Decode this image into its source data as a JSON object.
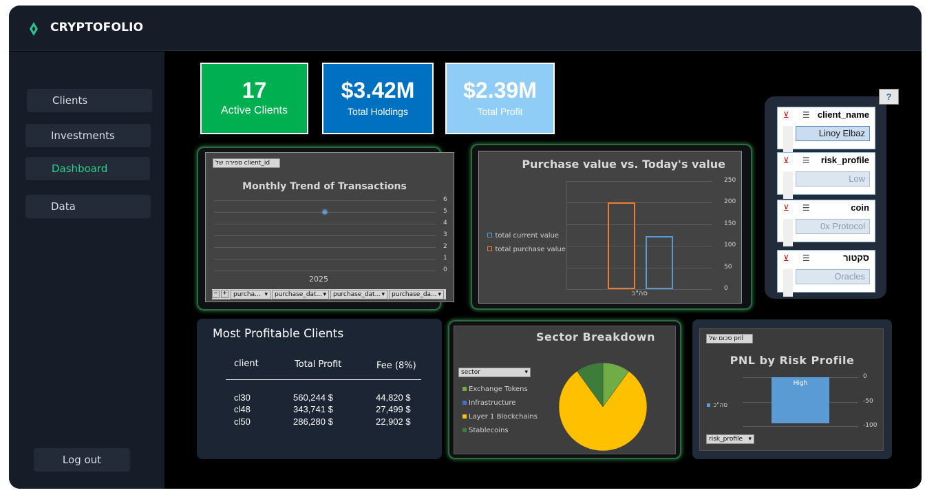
{
  "app": {
    "brand": "CRYPTOFOLIO"
  },
  "sidebar": {
    "items": [
      {
        "label": "Clients"
      },
      {
        "label": "Investments"
      },
      {
        "label": "Dashboard"
      },
      {
        "label": "Data"
      }
    ],
    "logout_label": "Log out"
  },
  "kpis": [
    {
      "value": "17",
      "label": "Active Clients",
      "color": "#00b050"
    },
    {
      "value": "$3.42M",
      "label": "Total Holdings",
      "color": "#0070c0"
    },
    {
      "value": "$2.39M",
      "label": "Total Profit",
      "color": "#8fcdf7"
    }
  ],
  "monthly_chart": {
    "field_chip": "ספירה של client_id",
    "title": "Monthly Trend of Transactions",
    "x_category": "2025",
    "yticks": [
      "6",
      "5",
      "4",
      "3",
      "2",
      "1",
      "0"
    ],
    "filters": [
      "purcha...",
      "purchase_dat...",
      "purchase_dat...",
      "purchase_da..."
    ]
  },
  "purchase_chart": {
    "title": "Purchase value vs. Today's value",
    "legend": [
      "total current value",
      "total purchase value"
    ],
    "yticks": [
      "250",
      "200",
      "150",
      "100",
      "50",
      "0"
    ],
    "category": "סה\"כ"
  },
  "slicers": [
    {
      "header": "client_name",
      "value": "Linoy Elbaz",
      "selected": true
    },
    {
      "header": "risk_profile",
      "value": "Low",
      "selected": false
    },
    {
      "header": "coin",
      "value": "0x Protocol",
      "selected": false
    },
    {
      "header": "סקטור",
      "value": "Oracles",
      "selected": false
    }
  ],
  "help_label": "?",
  "profitable": {
    "title": "Most Profitable Clients",
    "headers": [
      "client",
      "Total Profit",
      "Fee (8%)"
    ],
    "rows": [
      [
        "cl30",
        "560,244 $",
        "44,820 $"
      ],
      [
        "cl48",
        "343,741 $",
        "27,499 $"
      ],
      [
        "cl50",
        "286,280 $",
        "22,902 $"
      ]
    ]
  },
  "sector_chart": {
    "title": "Sector Breakdown",
    "filter_label": "sector",
    "legend": [
      {
        "name": "Exchange Tokens",
        "color": "#70ad47"
      },
      {
        "name": "Infrastructure",
        "color": "#4472c4"
      },
      {
        "name": "Layer 1 Blockchains",
        "color": "#ffc000"
      },
      {
        "name": "Stablecoins",
        "color": "#3e7c3a"
      }
    ]
  },
  "pnl_chart": {
    "field_chip": "סכום של pnl",
    "title": "PNL by Risk Profile",
    "legend": "סה\"כ",
    "bar_label": "High",
    "yticks": [
      "0",
      "-50",
      "-100"
    ],
    "filter_label": "risk_profile"
  },
  "chart_data": [
    {
      "type": "line",
      "title": "Monthly Trend of Transactions",
      "categories": [
        "2025"
      ],
      "series": [
        {
          "values": [
            5
          ]
        }
      ],
      "ylim": [
        0,
        6
      ]
    },
    {
      "type": "bar",
      "title": "Purchase value vs. Today's value",
      "categories": [
        "סה\"כ"
      ],
      "series": [
        {
          "name": "total purchase value",
          "values": [
            200
          ]
        },
        {
          "name": "total current value",
          "values": [
            122
          ]
        }
      ],
      "ylim": [
        0,
        250
      ]
    },
    {
      "type": "pie",
      "title": "Sector Breakdown",
      "categories": [
        "Exchange Tokens",
        "Infrastructure",
        "Layer 1 Blockchains",
        "Stablecoins"
      ],
      "values": [
        10,
        0,
        80,
        10
      ]
    },
    {
      "type": "bar",
      "title": "PNL by Risk Profile",
      "categories": [
        "High"
      ],
      "series": [
        {
          "name": "סה\"כ",
          "values": [
            -95
          ]
        }
      ],
      "ylim": [
        -100,
        0
      ]
    }
  ]
}
